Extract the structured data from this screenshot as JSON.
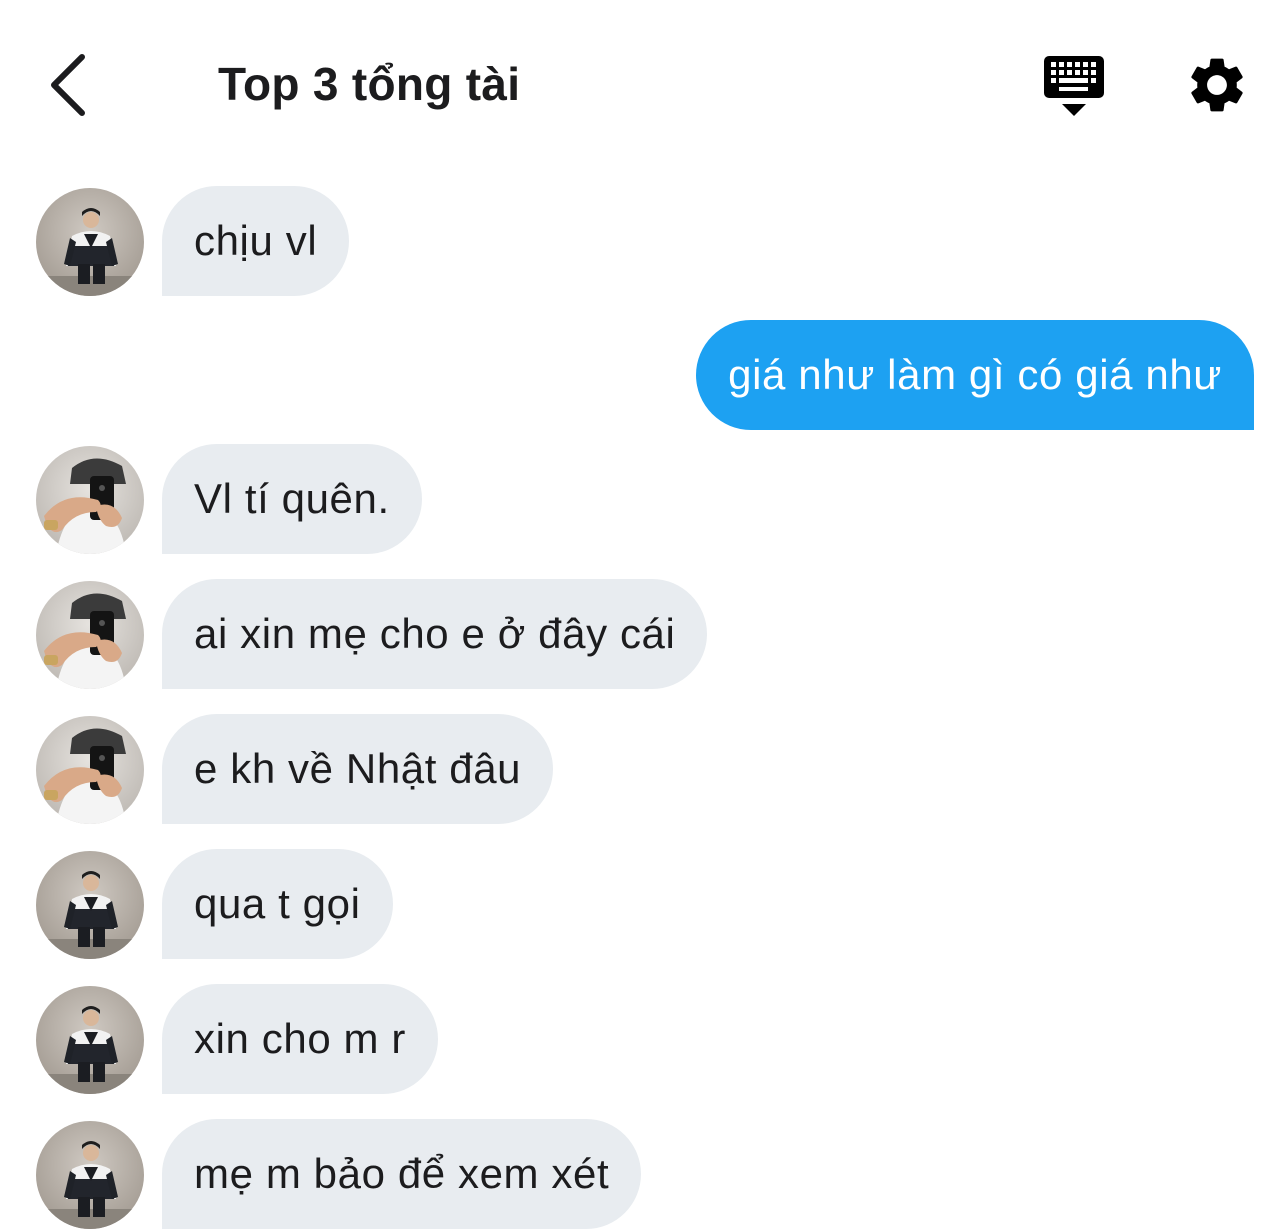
{
  "header": {
    "title": "Top 3 tổng tài",
    "back_icon": "chevron-left-icon",
    "keyboard_icon": "keyboard-hide-icon",
    "settings_icon": "gear-icon"
  },
  "colors": {
    "outgoing_bubble": "#1da1f2",
    "incoming_bubble": "#e8ecf0",
    "text": "#1c1c1e"
  },
  "messages": [
    {
      "direction": "incoming",
      "sender": "user-a",
      "text": "chịu vl"
    },
    {
      "direction": "outgoing",
      "text": "giá như làm gì có giá như"
    },
    {
      "direction": "incoming",
      "sender": "user-b",
      "text": "Vl tí quên."
    },
    {
      "direction": "incoming",
      "sender": "user-b",
      "text": "ai xin mẹ cho e ở đây cái"
    },
    {
      "direction": "incoming",
      "sender": "user-b",
      "text": "e kh về Nhật đâu"
    },
    {
      "direction": "incoming",
      "sender": "user-a",
      "text": "qua t gọi"
    },
    {
      "direction": "incoming",
      "sender": "user-a",
      "text": "xin cho m r"
    },
    {
      "direction": "incoming",
      "sender": "user-a",
      "text": "mẹ m bảo để xem xét"
    }
  ]
}
